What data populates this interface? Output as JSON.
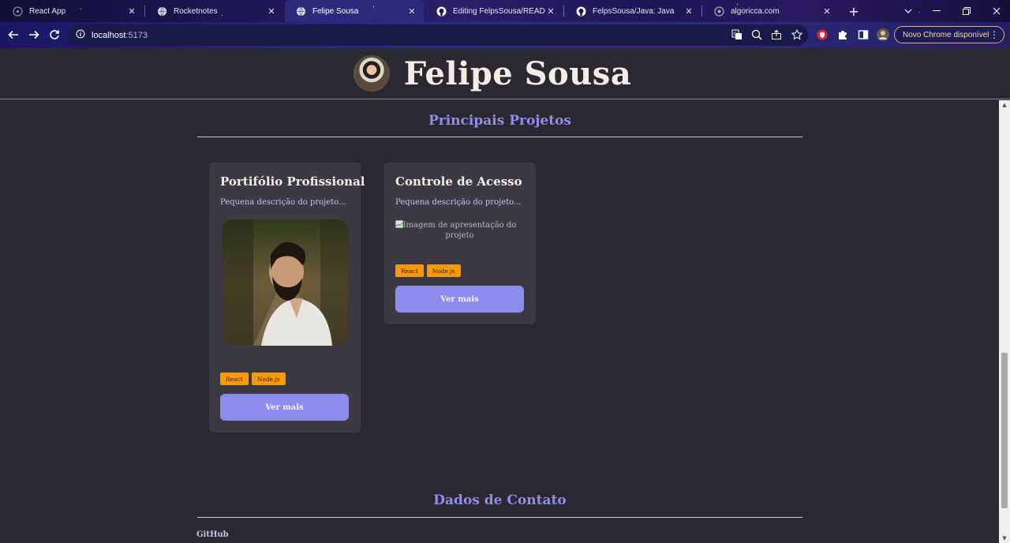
{
  "browser": {
    "tabs": [
      {
        "title": "React App",
        "icon": "react-icon"
      },
      {
        "title": "Rocketnotes",
        "icon": "globe-icon"
      },
      {
        "title": "Felipe Sousa",
        "icon": "globe-icon",
        "active": true
      },
      {
        "title": "Editing FelpsSousa/README",
        "icon": "github-icon"
      },
      {
        "title": "FelpsSousa/Java: Java",
        "icon": "github-icon"
      },
      {
        "title": "algoricca.com",
        "icon": "globe-icon"
      }
    ],
    "address": {
      "host": "localhost",
      "port": ":5173"
    },
    "update_label": "Novo Chrome disponível"
  },
  "header": {
    "name": "Felipe Sousa"
  },
  "projects_section": {
    "title": "Principais Projetos"
  },
  "projects": [
    {
      "title": "Portifólio Profissional",
      "description": "Pequena descrição do projeto...",
      "image_alt": "",
      "tags": [
        "React",
        "Node.js"
      ],
      "button": "Ver mais"
    },
    {
      "title": "Controle de Acesso",
      "description": "Pequena descrição do projeto...",
      "image_alt": "Imagem de apresentação do projeto",
      "tags": [
        "React",
        "Node.js"
      ],
      "button": "Ver mais"
    }
  ],
  "contact_section": {
    "title": "Dados de Contato",
    "links": [
      "GitHub"
    ]
  },
  "colors": {
    "accent": "#8c8cec",
    "tag": "#f59a0c",
    "background": "#2b2832",
    "card": "#3c3944"
  }
}
